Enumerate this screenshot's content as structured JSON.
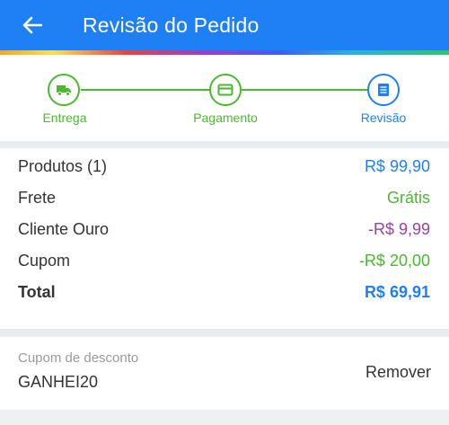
{
  "header": {
    "title": "Revisão do Pedido",
    "back_icon": "arrow-left-icon",
    "bg": "#1f7ff5"
  },
  "stepper": {
    "steps": [
      {
        "label": "Entrega",
        "icon": "truck-icon",
        "state": "done"
      },
      {
        "label": "Pagamento",
        "icon": "card-icon",
        "state": "done"
      },
      {
        "label": "Revisão",
        "icon": "receipt-icon",
        "state": "current"
      }
    ],
    "colors": {
      "done": "#4cb82f",
      "current": "#1f7ff5"
    }
  },
  "summary": {
    "rows": [
      {
        "label": "Produtos (1)",
        "value": "R$ 99,90",
        "color": "#1f7ff5"
      },
      {
        "label": "Frete",
        "value": "Grátis",
        "color": "#4cb82f"
      },
      {
        "label": "Cliente Ouro",
        "value": "-R$ 9,99",
        "color": "#9b3fa0"
      },
      {
        "label": "Cupom",
        "value": "-R$ 20,00",
        "color": "#4cb82f"
      },
      {
        "label": "Total",
        "value": "R$ 69,91",
        "color": "#1f7ff5",
        "bold": true
      }
    ]
  },
  "coupon": {
    "label": "Cupom de desconto",
    "code": "GANHEI20",
    "remove_label": "Remover"
  }
}
